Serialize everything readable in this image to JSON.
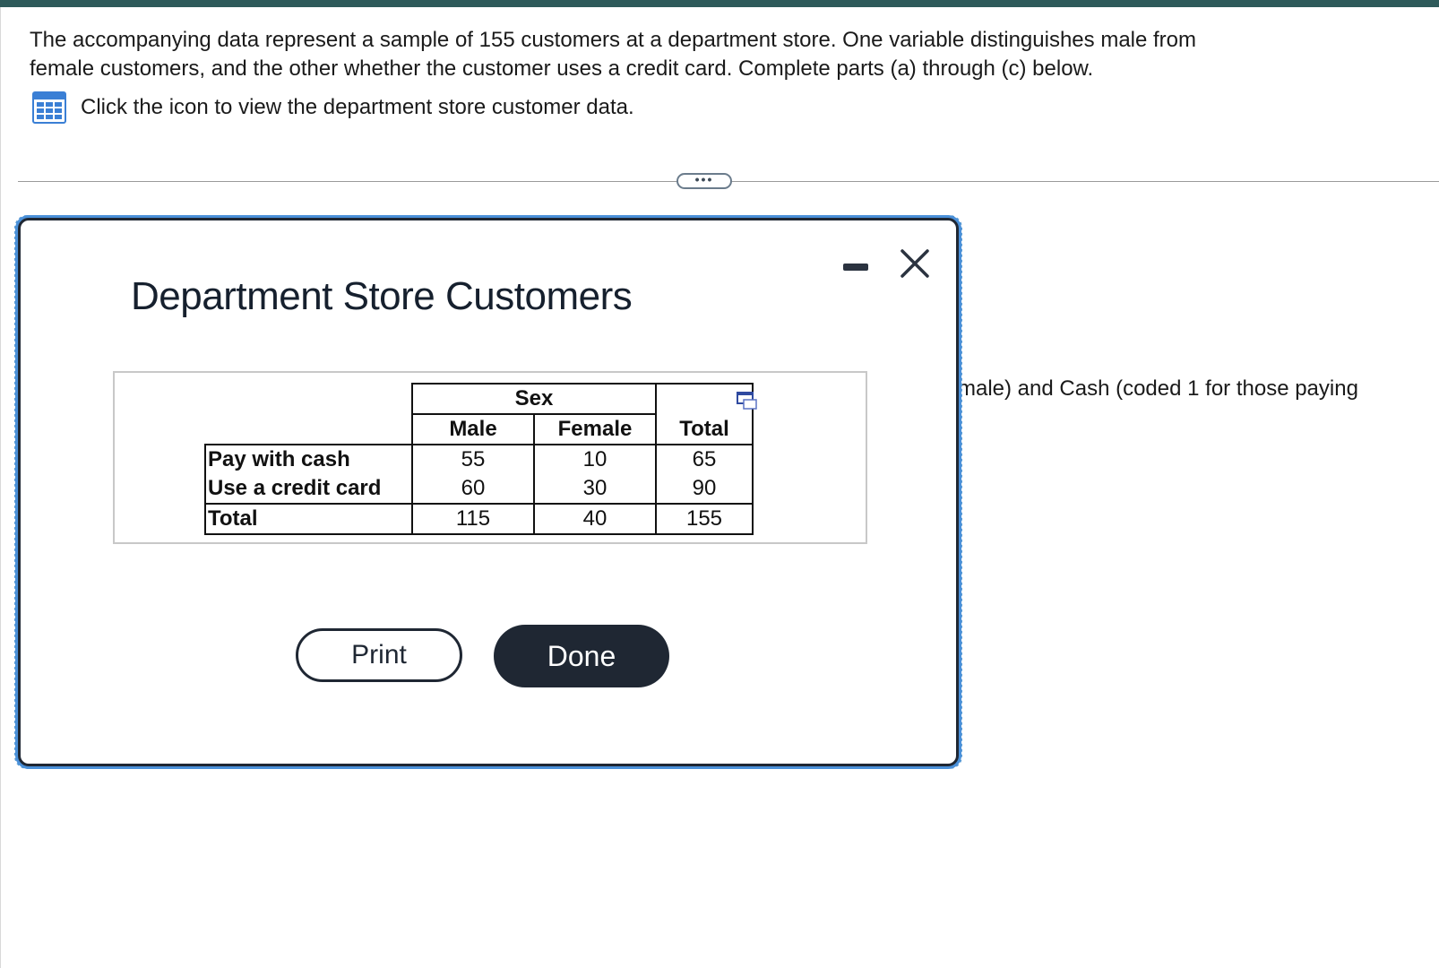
{
  "prompt": {
    "line1": "The accompanying data represent a sample of 155 customers at a department store. One variable distinguishes male from",
    "line2": "female customers, and the other whether the customer uses a credit card. Complete parts (a) through (c) below.",
    "data_link_text": "Click the icon to view the department store customer data.",
    "data_link_icon": "table-grid-icon"
  },
  "more_button_label": "•••",
  "behind_modal_text": "male) and Cash (coded 1 for those paying",
  "modal": {
    "title": "Department Store Customers",
    "minimize_icon": "minimize-icon",
    "close_icon": "close-icon",
    "copy_icon": "copy-table-icon",
    "table": {
      "group_header": "Sex",
      "columns": [
        "Male",
        "Female",
        "Total"
      ],
      "rows": [
        {
          "label": "Pay with cash",
          "values": [
            "55",
            "10",
            "65"
          ]
        },
        {
          "label": "Use a credit card",
          "values": [
            "60",
            "30",
            "90"
          ]
        },
        {
          "label": "Total",
          "values": [
            "115",
            "40",
            "155"
          ]
        }
      ]
    },
    "print_label": "Print",
    "done_label": "Done"
  },
  "colors": {
    "top_bar": "#2e5a5a",
    "modal_border": "#1f2733",
    "focus_ring": "#4a90d9",
    "done_button_bg": "#1f2733",
    "icon_blue": "#3a7fd5"
  }
}
